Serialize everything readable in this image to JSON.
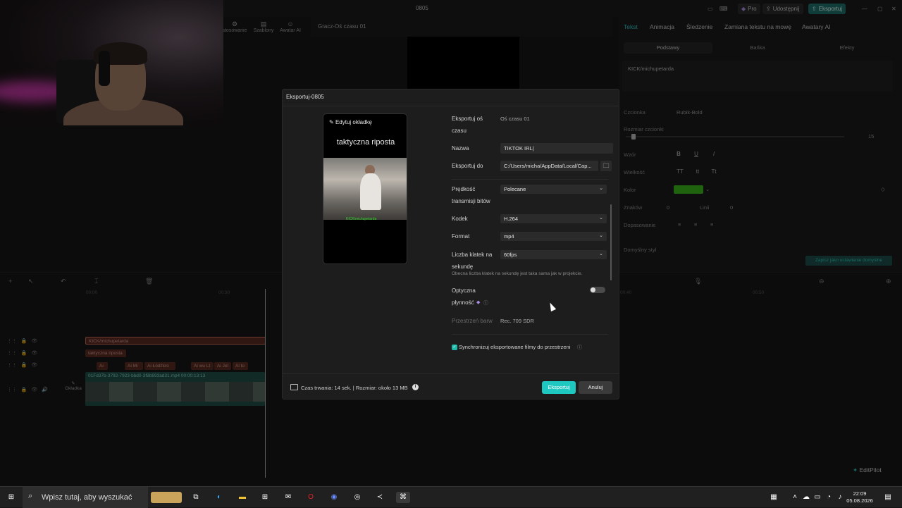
{
  "app": {
    "title": "0805",
    "pro_label": "Pro",
    "share_label": "Udostępnij",
    "export_label": "Eksportuj",
    "toolstrip": [
      "stosowanie",
      "Szablony",
      "Awatar AI"
    ]
  },
  "preview": {
    "label": "Gracz-Oś czasu 01"
  },
  "right_panel": {
    "tabs": [
      "Tekst",
      "Animacja",
      "Śledzenie",
      "Zamiana tekstu na mowę",
      "Awatary AI"
    ],
    "subtabs": [
      "Podstawy",
      "Bańka",
      "Efekty"
    ],
    "text_content": "KICK/michupetarda",
    "font_label": "Czcionka",
    "font_value": "Rubik-Bold",
    "size_label": "Rozmiar czcionki",
    "size_value": "15",
    "pattern_label": "Wzór",
    "case_label": "Wielkość",
    "color_label": "Kolor",
    "color_value": "#3bb51c",
    "chars_label": "Znaków",
    "chars_value": "0",
    "lines_label": "Linii",
    "lines_value": "0",
    "align_label": "Dopasowanie",
    "default_style_label": "Domyślny styl",
    "save_default": "Zapisz jako ustawienie domyślne"
  },
  "timeline": {
    "time_start": "00:00",
    "time_mid": "00:30",
    "time_right": "00:40",
    "time_far": "00:50",
    "clip_text_1": "KICK/michupetarda",
    "clip_text_2": "taktyczna riposta",
    "clip_small": [
      "Ai",
      "Ai Mi",
      "Ai Łódźkro",
      "Ai wu Lt",
      "Ai Jel",
      "Ai to"
    ],
    "video_clip_label": "01Fd37b-3792-7923-bbd0-3f8b893ad31.mp4  00:00:13:13",
    "cover_label": "Okładka"
  },
  "dialog": {
    "title": "Eksportuj-0805",
    "cover_edit": "Edytuj okładkę",
    "cover_caption": "taktyczna riposta",
    "cover_tag": "KICK/michupetarda",
    "timeline_label": "Eksportuj oś czasu",
    "timeline_value": "Oś czasu 01",
    "name_label": "Nazwa",
    "name_value": "TIKTOK IRL|",
    "export_to_label": "Eksportuj do",
    "export_to_value": "C:/Users/micha/AppData/Local/Cap...",
    "bitrate_label": "Prędkość transmisji bitów",
    "bitrate_value": "Polecane",
    "codec_label": "Kodek",
    "codec_value": "H.264",
    "format_label": "Format",
    "format_value": "mp4",
    "fps_label": "Liczba klatek na sekundę",
    "fps_value": "60fps",
    "fps_hint": "Obecna liczba klatek na sekundę jest taka sama jak w projekcie.",
    "optical_label": "Optyczna płynność",
    "color_space_label": "Przestrzeń barw",
    "color_space_value": "Rec. 709 SDR",
    "sync_label": "Synchronizuj eksportowane filmy do przestrzeni",
    "footer_info": "Czas trwania: 14 sek. | Rozmiar: około 13 MB",
    "export_button": "Eksportuj",
    "cancel_button": "Anuluj"
  },
  "taskbar": {
    "search_placeholder": "Wpisz tutaj, aby wyszukać",
    "time": "22:09",
    "date": "05.08.2026",
    "editpilot": "EditPilot"
  }
}
